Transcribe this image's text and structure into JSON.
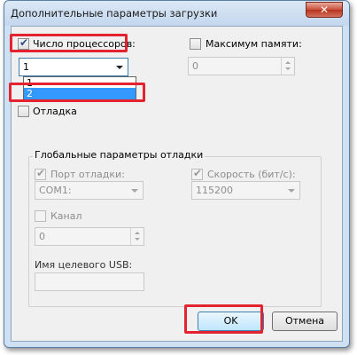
{
  "window": {
    "title": "Дополнительные параметры загрузки",
    "close_label": "✕"
  },
  "processors": {
    "label": "Число процессоров:",
    "checked": true,
    "selected": "1",
    "options": [
      "1",
      "2"
    ],
    "highlighted_option": "2"
  },
  "max_memory": {
    "label": "Максимум памяти:",
    "checked": false,
    "value": "0"
  },
  "debug": {
    "label": "Отладка",
    "checked": false
  },
  "global_debug": {
    "title": "Глобальные параметры отладки",
    "debug_port": {
      "label": "Порт отладки:",
      "checked": true,
      "value": "COM1:"
    },
    "baud_rate": {
      "label": "Скорость (бит/с):",
      "checked": true,
      "value": "115200"
    },
    "channel": {
      "label": "Канал",
      "checked": false,
      "value": "0"
    },
    "usb_target": {
      "label": "Имя целевого USB:",
      "value": ""
    }
  },
  "buttons": {
    "ok": "OK",
    "cancel": "Отмена"
  },
  "colors": {
    "highlight": "#e3232f",
    "selection": "#3399ff",
    "window_frame": "#cfe0f2"
  }
}
